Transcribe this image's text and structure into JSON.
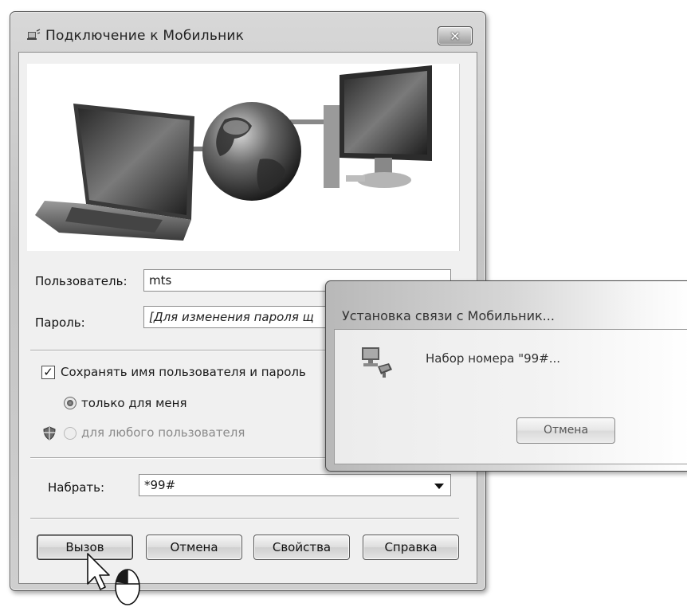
{
  "main_dialog": {
    "title": "Подключение к Мобильник",
    "close_label": "✕",
    "user_label": "Пользователь:",
    "user_value": "mts",
    "password_label": "Пароль:",
    "password_value": "[Для изменения пароля щ",
    "save_checkbox_label": "Сохранять имя пользователя и пароль",
    "save_checked": true,
    "radio_me_label": "только для меня",
    "radio_any_label": "для любого пользователя",
    "dial_label": "Набрать:",
    "dial_value": "*99#",
    "buttons": {
      "call": "Вызов",
      "cancel": "Отмена",
      "properties": "Свойства",
      "help": "Справка"
    }
  },
  "progress_popup": {
    "title": "Установка связи с Мобильник...",
    "status": "Набор номера \"99#...",
    "cancel": "Отмена"
  }
}
